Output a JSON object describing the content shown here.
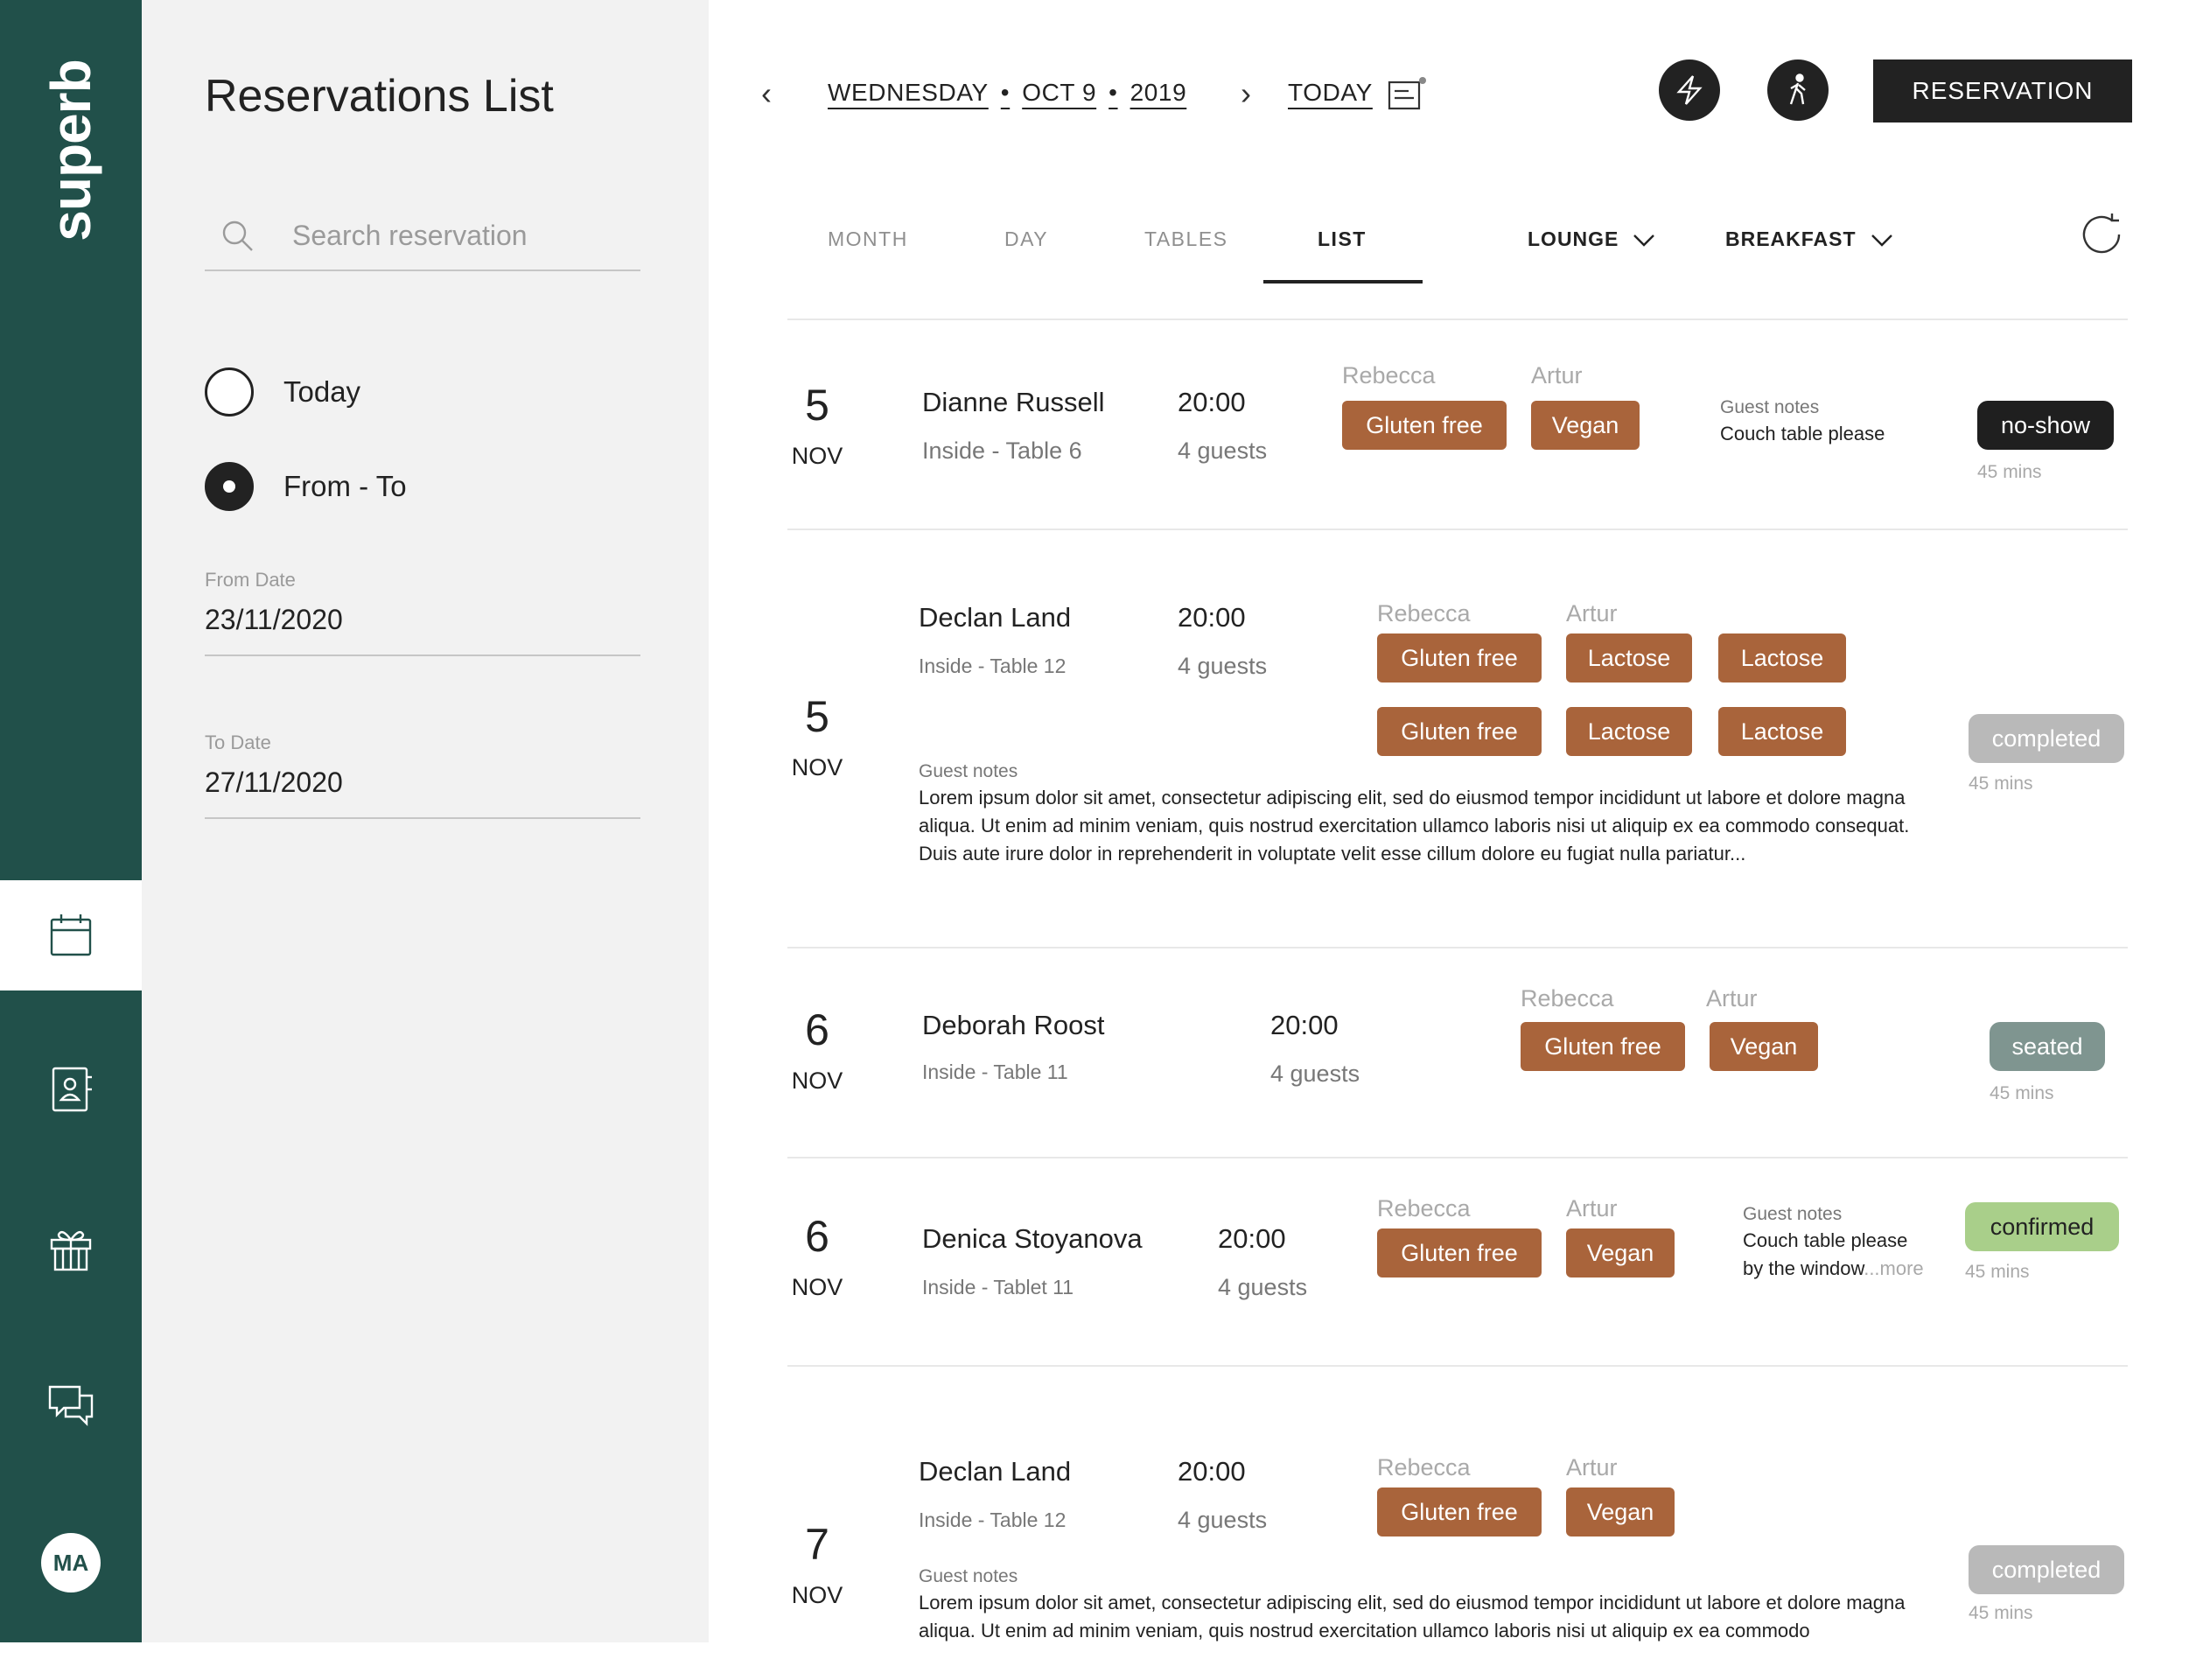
{
  "brand": "superb",
  "nav": {
    "items": [
      {
        "name": "calendar",
        "active": true
      },
      {
        "name": "guest-book",
        "active": false
      },
      {
        "name": "gift",
        "active": false
      },
      {
        "name": "chat",
        "active": false
      }
    ],
    "avatar_initials": "MA"
  },
  "panel": {
    "title": "Reservations List",
    "search_placeholder": "Search reservation",
    "radio_today": "Today",
    "radio_range": "From - To",
    "selected": "From - To",
    "from_label": "From Date",
    "from_value": "23/11/2020",
    "to_label": "To Date",
    "to_value": "27/11/2020"
  },
  "header": {
    "weekday": "WEDNESDAY",
    "sep": "•",
    "month_day": "OCT 9",
    "year": "2019",
    "today_label": "TODAY",
    "reservation_button": "RESERVATION"
  },
  "tabs": {
    "month": "MONTH",
    "day": "DAY",
    "tables": "TABLES",
    "list": "LIST",
    "active": "LIST",
    "area": "LOUNGE",
    "shift": "BREAKFAST"
  },
  "reservations": [
    {
      "day": "5",
      "month": "NOV",
      "name": "Dianne Russell",
      "location": "Inside  -  Table 6",
      "time": "20:00",
      "guests": "4 guests",
      "staff": [
        "Rebecca",
        "Artur"
      ],
      "tags": [
        "Gluten free",
        "Vegan"
      ],
      "notes_label": "Guest notes",
      "notes": "Couch table please",
      "status": "no-show",
      "duration": "45 mins"
    },
    {
      "day": "5",
      "month": "NOV",
      "name": "Declan Land",
      "location": "Inside  -  Table 12",
      "time": "20:00",
      "guests": "4 guests",
      "staff": [
        "Rebecca",
        "Artur"
      ],
      "tags": [
        "Gluten free",
        "Lactose",
        "Lactose",
        "Gluten free",
        "Lactose",
        "Lactose"
      ],
      "notes_label": "Guest notes",
      "notes": "Lorem ipsum dolor sit amet, consectetur adipiscing elit, sed do eiusmod tempor incididunt ut labore et dolore magna aliqua. Ut enim ad minim veniam, quis nostrud exercitation ullamco laboris nisi ut aliquip ex ea commodo consequat. Duis aute irure dolor in reprehenderit in voluptate velit esse cillum dolore eu fugiat nulla pariatur...",
      "status": "completed",
      "duration": "45 mins"
    },
    {
      "day": "6",
      "month": "NOV",
      "name": "Deborah Roost",
      "location": "Inside  -  Table 11",
      "time": "20:00",
      "guests": "4 guests",
      "staff": [
        "Rebecca",
        "Artur"
      ],
      "tags": [
        "Gluten free",
        "Vegan"
      ],
      "status": "seated",
      "duration": "45 mins"
    },
    {
      "day": "6",
      "month": "NOV",
      "name": "Denica Stoyanova",
      "location": "Inside  -  Tablet 11",
      "time": "20:00",
      "guests": "4 guests",
      "staff": [
        "Rebecca",
        "Artur"
      ],
      "tags": [
        "Gluten free",
        "Vegan"
      ],
      "notes_label": "Guest notes",
      "notes": "Couch table please",
      "notes_line2": "by the window",
      "more": "...more",
      "status": "confirmed",
      "duration": "45 mins"
    },
    {
      "day": "7",
      "month": "NOV",
      "name": "Declan Land",
      "location": "Inside  -  Table 12",
      "time": "20:00",
      "guests": "4 guests",
      "staff": [
        "Rebecca",
        "Artur"
      ],
      "tags": [
        "Gluten free",
        "Vegan"
      ],
      "notes_label": "Guest notes",
      "notes": "Lorem ipsum dolor sit amet, consectetur adipiscing elit, sed do eiusmod tempor incididunt ut labore et dolore magna aliqua. Ut enim ad minim veniam, quis nostrud exercitation ullamco laboris nisi ut aliquip ex ea commodo",
      "status": "completed",
      "duration": "45 mins"
    }
  ],
  "colors": {
    "rail": "#21504a",
    "tag": "#a9643b",
    "no_show": "#1f1f1f",
    "completed": "#b9b9b9",
    "seated": "#7f9590",
    "confirmed": "#a9cf8a"
  }
}
